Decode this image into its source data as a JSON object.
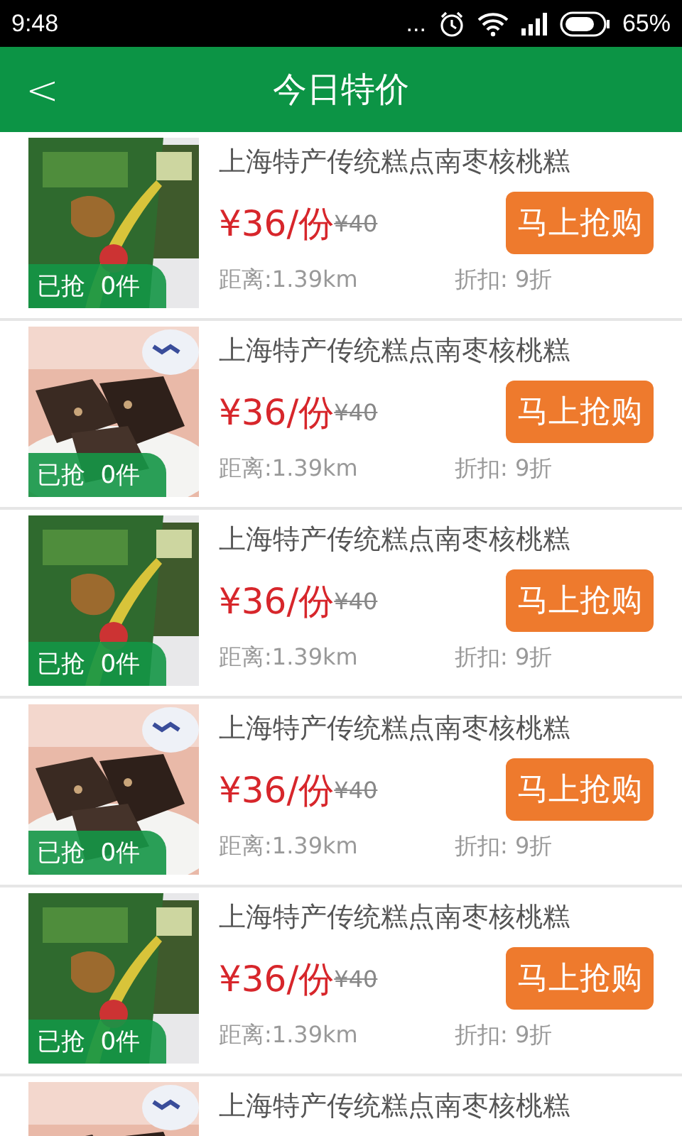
{
  "status_bar": {
    "time": "9:48",
    "more": "...",
    "battery": "65%"
  },
  "header": {
    "back": "<",
    "title": "今日特价"
  },
  "deals": [
    {
      "title": "上海特产传统糕点南枣核桃糕",
      "price": "¥36/份",
      "old_price": "¥40",
      "buy": "马上抢购",
      "sold": "已抢  0件",
      "distance": "距离:1.39km",
      "discount": "折扣: 9折"
    },
    {
      "title": "上海特产传统糕点南枣核桃糕",
      "price": "¥36/份",
      "old_price": "¥40",
      "buy": "马上抢购",
      "sold": "已抢  0件",
      "distance": "距离:1.39km",
      "discount": "折扣: 9折"
    },
    {
      "title": "上海特产传统糕点南枣核桃糕",
      "price": "¥36/份",
      "old_price": "¥40",
      "buy": "马上抢购",
      "sold": "已抢  0件",
      "distance": "距离:1.39km",
      "discount": "折扣: 9折"
    },
    {
      "title": "上海特产传统糕点南枣核桃糕",
      "price": "¥36/份",
      "old_price": "¥40",
      "buy": "马上抢购",
      "sold": "已抢  0件",
      "distance": "距离:1.39km",
      "discount": "折扣: 9折"
    },
    {
      "title": "上海特产传统糕点南枣核桃糕",
      "price": "¥36/份",
      "old_price": "¥40",
      "buy": "马上抢购",
      "sold": "已抢  0件",
      "distance": "距离:1.39km",
      "discount": "折扣: 9折"
    },
    {
      "title": "上海特产传统糕点南枣核桃糕"
    }
  ]
}
